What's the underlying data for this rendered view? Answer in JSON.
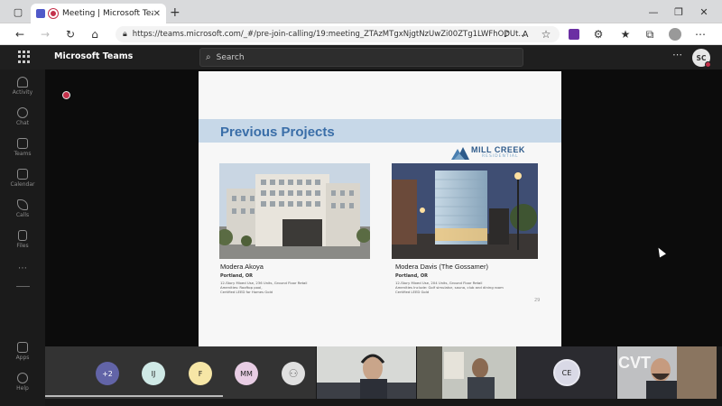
{
  "browser": {
    "tab_title": "Meeting | Microsoft Teams",
    "url": "https://teams.microsoft.com/_#/pre-join-calling/19:meeting_ZTAzMTgxNjgtNzUwZi00ZTg1LWFhODUt..."
  },
  "teams": {
    "app_name": "Microsoft Teams",
    "search_placeholder": "Search",
    "user_initials": "SC"
  },
  "rail": [
    {
      "label": "Activity",
      "icon": "bell-icon"
    },
    {
      "label": "Chat",
      "icon": "chat-icon"
    },
    {
      "label": "Teams",
      "icon": "teams-icon"
    },
    {
      "label": "Calendar",
      "icon": "calendar-icon"
    },
    {
      "label": "Calls",
      "icon": "phone-icon"
    },
    {
      "label": "Files",
      "icon": "file-icon"
    },
    {
      "label": "Apps",
      "icon": "apps-icon"
    },
    {
      "label": "Help",
      "icon": "help-icon"
    }
  ],
  "slide": {
    "title": "Previous Projects",
    "logo_text": "MILL CREEK",
    "logo_subtext": "RESIDENTIAL",
    "projects": [
      {
        "name": "Modera Akoya",
        "location": "Portland, OR",
        "details": [
          "12-Story Mixed Use, 236 Units, Ground Floor Retail",
          "Amenities: Rooftop pool,",
          "Certified LEED for Homes Gold"
        ]
      },
      {
        "name": "Modera Davis (The Gossamer)",
        "location": "Portland, OR",
        "details": [
          "12-Story Mixed Use, 204 Units, Ground Floor Retail",
          "Amenities Include: Golf simulator, sauna, club and dining room",
          "Certified LEED Gold"
        ]
      }
    ],
    "page_number": "29"
  },
  "participants": {
    "overflow": "+2",
    "initials": [
      "IJ",
      "F",
      "MM"
    ],
    "tile_initials": "CE",
    "tile_brand": "CVT"
  },
  "colors": {
    "slide_title": "#3a6ea8",
    "band": "#c7d8e8",
    "recording": "#c4314b"
  }
}
